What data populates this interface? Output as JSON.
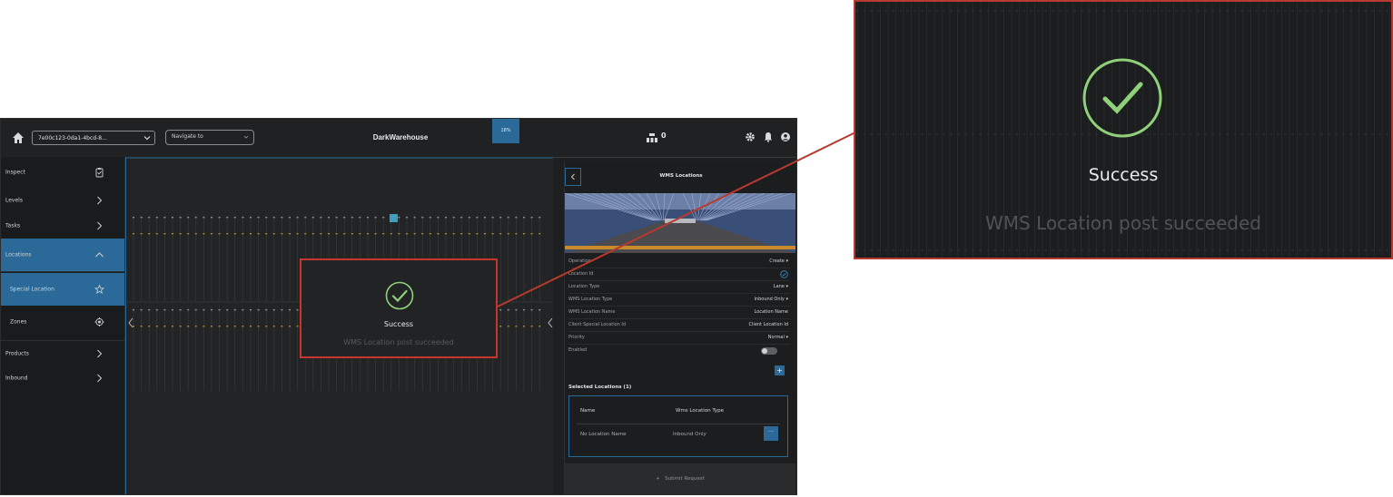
{
  "topbar": {
    "warehouse_select_value": "7e00c123-0da1-4bcd-8...",
    "navigate_placeholder": "Navigate to",
    "app_title": "DarkWarehouse",
    "progress_badge": "18%",
    "counter_value": "0"
  },
  "sidebar": {
    "items": [
      {
        "label": "Inspect",
        "icon": "clipboard-check-icon"
      },
      {
        "label": "Levels",
        "icon": "chevron-right-icon"
      },
      {
        "label": "Tasks",
        "icon": "chevron-right-icon"
      },
      {
        "label": "Locations",
        "icon": "chevron-up-icon",
        "active": true
      },
      {
        "label": "Special Location",
        "icon": "star-icon",
        "active": true
      },
      {
        "label": "Zones",
        "icon": "target-icon"
      },
      {
        "label": "Products",
        "icon": "chevron-right-icon"
      },
      {
        "label": "Inbound",
        "icon": "chevron-right-icon"
      }
    ]
  },
  "panel": {
    "title": "WMS Locations",
    "fields": [
      {
        "label": "Operation",
        "value": "Create"
      },
      {
        "label": "Location Id",
        "value": ""
      },
      {
        "label": "Location Type",
        "value": "Lane"
      },
      {
        "label": "WMS Location Type",
        "value": "Inbound Only"
      },
      {
        "label": "WMS Location Name",
        "value": "Location Name"
      },
      {
        "label": "Client Special Location Id",
        "value": "Client Location Id"
      },
      {
        "label": "Priority",
        "value": "Normal"
      },
      {
        "label": "Enabled",
        "value": ""
      }
    ],
    "selected_title": "Selected Locations (1)",
    "table": {
      "headers": [
        "Name",
        "Wms Location Type"
      ],
      "rows": [
        [
          "No Location Name",
          "Inbound Only"
        ]
      ]
    },
    "submit_label": "Submit Request"
  },
  "toast": {
    "title": "Success",
    "message": "WMS Location post succeeded"
  },
  "colors": {
    "accent": "#2b6a98",
    "highlight_border": "#c5372b",
    "success_green": "#8fd17a"
  }
}
